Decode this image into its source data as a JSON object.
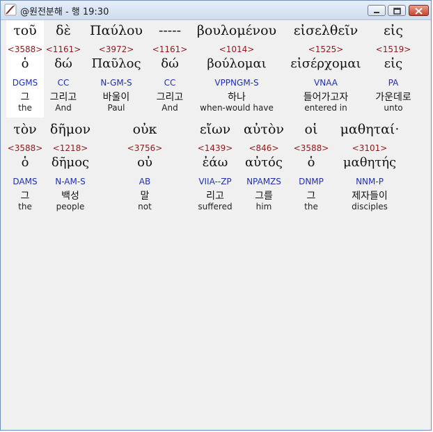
{
  "window": {
    "title": "@원전분해 - 행 19:30",
    "icon": "app-feather-icon",
    "controls": [
      "minimize-icon",
      "maximize-icon",
      "close-icon"
    ]
  },
  "rows": [
    {
      "words": [
        {
          "greek": "τοῦ",
          "strongs": "<3588>",
          "lemma": "ὁ",
          "morph": "DGMS",
          "korean": "그",
          "english": "the"
        },
        {
          "greek": "δὲ",
          "strongs": "<1161>",
          "lemma": "δώ",
          "morph": "CC",
          "korean": "그리고",
          "english": "And"
        },
        {
          "greek": "Παύλου",
          "strongs": "<3972>",
          "lemma": "Παῦλος",
          "morph": "N-GM-S",
          "korean": "바울이",
          "english": "Paul"
        },
        {
          "greek": "-----",
          "strongs": "<1161>",
          "lemma": "δώ",
          "morph": "CC",
          "korean": "그리고",
          "english": "And"
        },
        {
          "greek": "βουλομένου",
          "strongs": "<1014>",
          "lemma": "βούλομαι",
          "morph": "VPPNGM-S",
          "korean": "하나",
          "english": "when-would have"
        },
        {
          "greek": "εἰσελθεῖν",
          "strongs": "<1525>",
          "lemma": "εἰσέρχομαι",
          "morph": "VNAA",
          "korean": "들어가고자",
          "english": "entered in"
        },
        {
          "greek": "εἰς",
          "strongs": "<1519>",
          "lemma": "εἰς",
          "morph": "PA",
          "korean": "가운데로",
          "english": "unto"
        }
      ]
    },
    {
      "words": [
        {
          "greek": "τὸν",
          "strongs": "<3588>",
          "lemma": "ὁ",
          "morph": "DAMS",
          "korean": "그",
          "english": "the"
        },
        {
          "greek": "δῆμον",
          "strongs": "<1218>",
          "lemma": "δῆμος",
          "morph": "N-AM-S",
          "korean": "백성",
          "english": "people"
        },
        {
          "greek": "οὐκ",
          "strongs": "<3756>",
          "lemma": "οὐ",
          "morph": "AB",
          "korean": "말",
          "english": "not"
        },
        {
          "greek": "εἴων",
          "strongs": "<1439>",
          "lemma": "ἐάω",
          "morph": "VIIA--ZP",
          "korean": "리고",
          "english": "suffered"
        },
        {
          "greek": "αὐτὸν",
          "strongs": "<846>",
          "lemma": "αὐτός",
          "morph": "NPAMZS",
          "korean": "그를",
          "english": "him"
        },
        {
          "greek": "οἱ",
          "strongs": "<3588>",
          "lemma": "ὁ",
          "morph": "DNMP",
          "korean": "그",
          "english": "the"
        },
        {
          "greek": "μαθηταί·",
          "strongs": "<3101>",
          "lemma": "μαθητής",
          "morph": "NNM-P",
          "korean": "제자들이",
          "english": "disciples"
        }
      ]
    }
  ]
}
